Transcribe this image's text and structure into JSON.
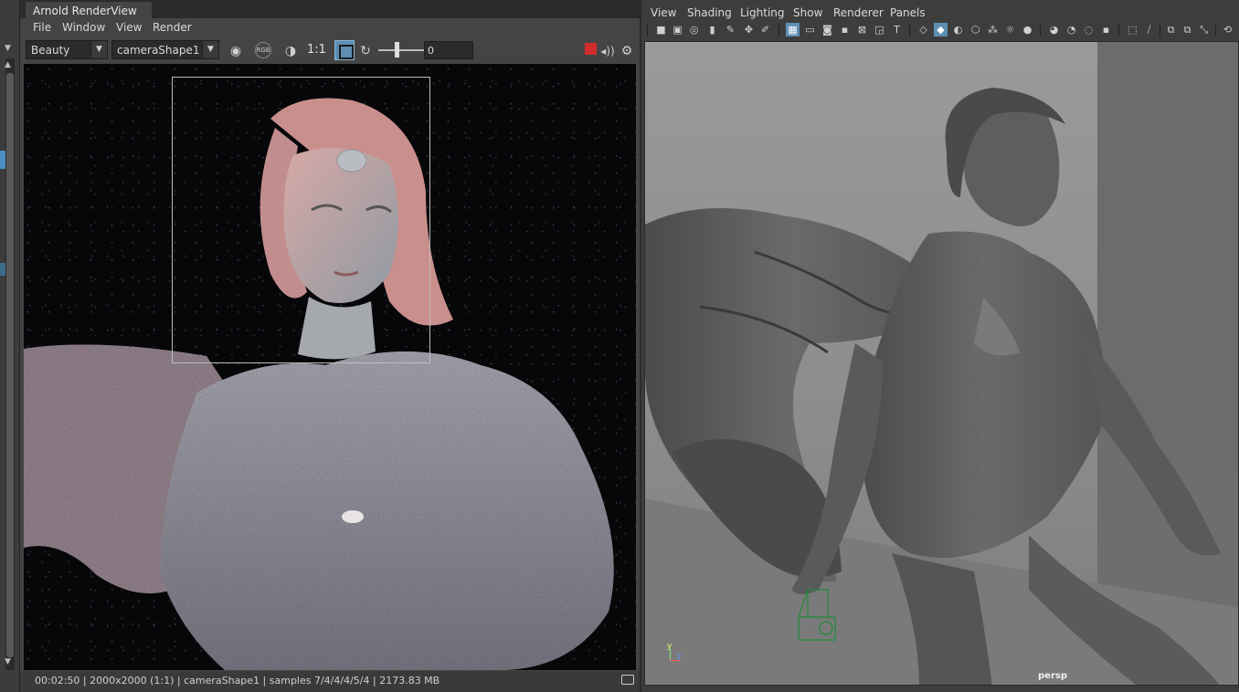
{
  "left_strip": {
    "top_arrow": "▼",
    "scroll_up": "▲",
    "scroll_down": "▼"
  },
  "arnold": {
    "window_title": "Arnold RenderView",
    "menu": [
      "File",
      "Window",
      "View",
      "Render"
    ],
    "toolbar": {
      "aov_select": "Beauty",
      "camera_select": "cameraShape1",
      "zoom_label": "1:1",
      "exposure_value": "0"
    },
    "status": "00:02:50 | 2000x2000 (1:1) | cameraShape1  | samples 7/4/4/4/5/4 | 2173.83 MB"
  },
  "viewport": {
    "menu": [
      "View",
      "Shading",
      "Lighting",
      "Show",
      "Renderer",
      "Panels"
    ],
    "camera_label": "persp",
    "axis_y": "y",
    "axis_z": "z"
  },
  "colors": {
    "accent": "#5d8fb5",
    "stop": "#d02c2c",
    "panel_bg": "#444444",
    "viewport_bg": "#8a8a8a"
  },
  "icons": {
    "render_toolbar": [
      "snapshot-icon",
      "rgb-icon",
      "color-correct-icon",
      "crop-region-icon",
      "refresh-icon",
      "stop-icon",
      "sound-icon",
      "settings-icon"
    ],
    "viewport_toolbar": [
      "select-camera-icon",
      "camera-attributes-icon",
      "bookmark-icon",
      "image-plane-icon",
      "grid-icon",
      "film-gate-icon",
      "resolution-gate-icon",
      "wireframe-icon",
      "smooth-shade-icon",
      "textured-icon",
      "lights-icon",
      "shadows-icon",
      "isolate-icon",
      "xray-icon",
      "exposure-icon",
      "gamma-icon"
    ]
  }
}
